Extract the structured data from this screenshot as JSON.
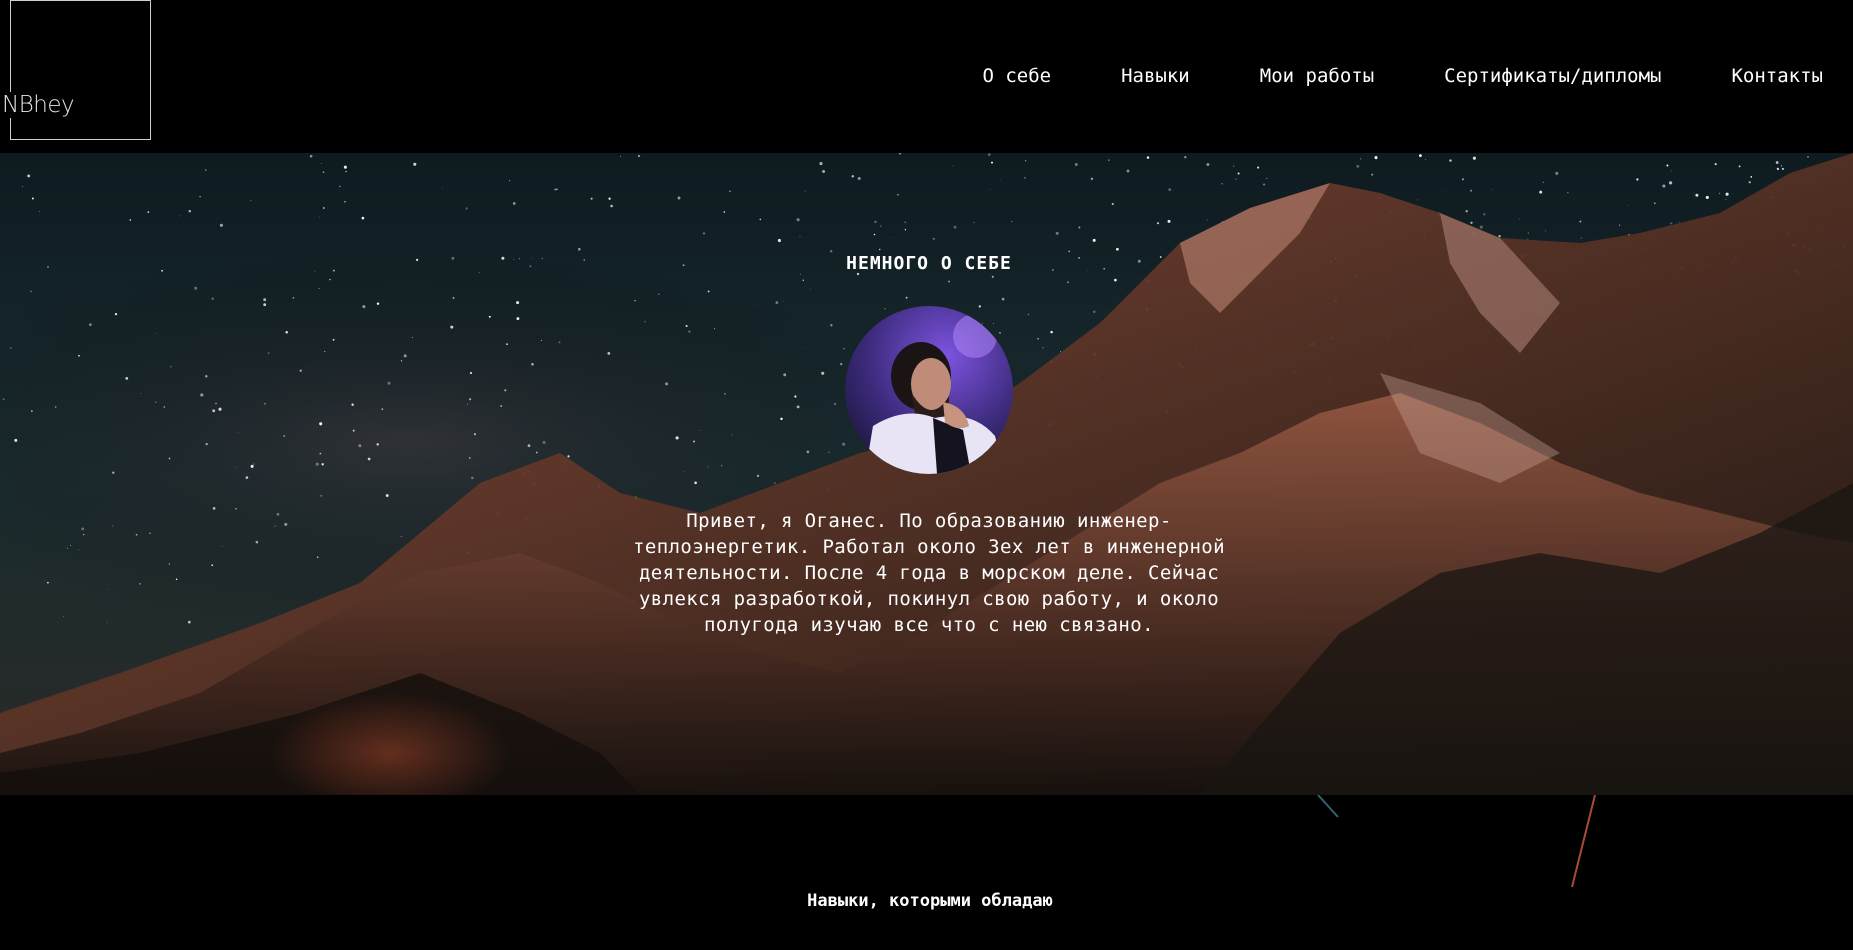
{
  "header": {
    "logo_text": "NBhey",
    "nav": [
      {
        "label": "О себе"
      },
      {
        "label": "Навыки"
      },
      {
        "label": "Мои работы"
      },
      {
        "label": "Сертификаты/дипломы"
      },
      {
        "label": "Контакты"
      }
    ]
  },
  "about": {
    "title": "НЕМНОГО О СЕБЕ",
    "text": "Привет, я Оганес. По образованию инженер-теплоэнергетик. Работал около 3ех лет в инженерной деятельности. После 4 года в морском деле. Сейчас увлекся разработкой, покинул свою работу, и около полугода изучаю все что с нею связано."
  },
  "skills": {
    "title": "Навыки, которыми обладаю"
  },
  "colors": {
    "background": "#000000",
    "text": "#ffffff",
    "logo_border": "#cfcfcf",
    "mountain_glow": "#b66a4a",
    "avatar_accent": "#6a3fc9"
  },
  "icons": {
    "avatar": "profile-photo"
  }
}
